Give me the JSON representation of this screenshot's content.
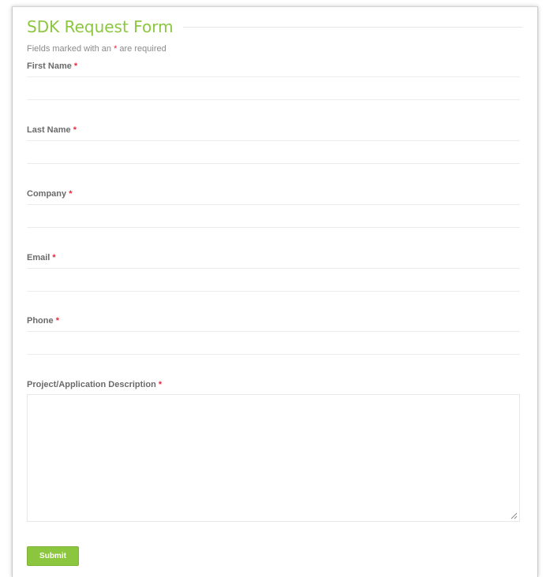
{
  "form": {
    "title": "SDK Request Form",
    "required_note_prefix": "Fields marked with an",
    "required_note_suffix": "are required",
    "required_marker": "*",
    "fields": [
      {
        "label": "First Name",
        "value": "",
        "type": "text"
      },
      {
        "label": "Last Name",
        "value": "",
        "type": "text"
      },
      {
        "label": "Company",
        "value": "",
        "type": "text"
      },
      {
        "label": "Email",
        "value": "",
        "type": "text"
      },
      {
        "label": "Phone",
        "value": "",
        "type": "text"
      },
      {
        "label": "Project/Application Description",
        "value": "",
        "type": "textarea"
      }
    ],
    "submit_label": "Submit"
  },
  "colors": {
    "accent": "#8cc63f",
    "required_star": "#e8273c",
    "label_text": "#6a6a6a",
    "note_text": "#8a8a8a"
  }
}
